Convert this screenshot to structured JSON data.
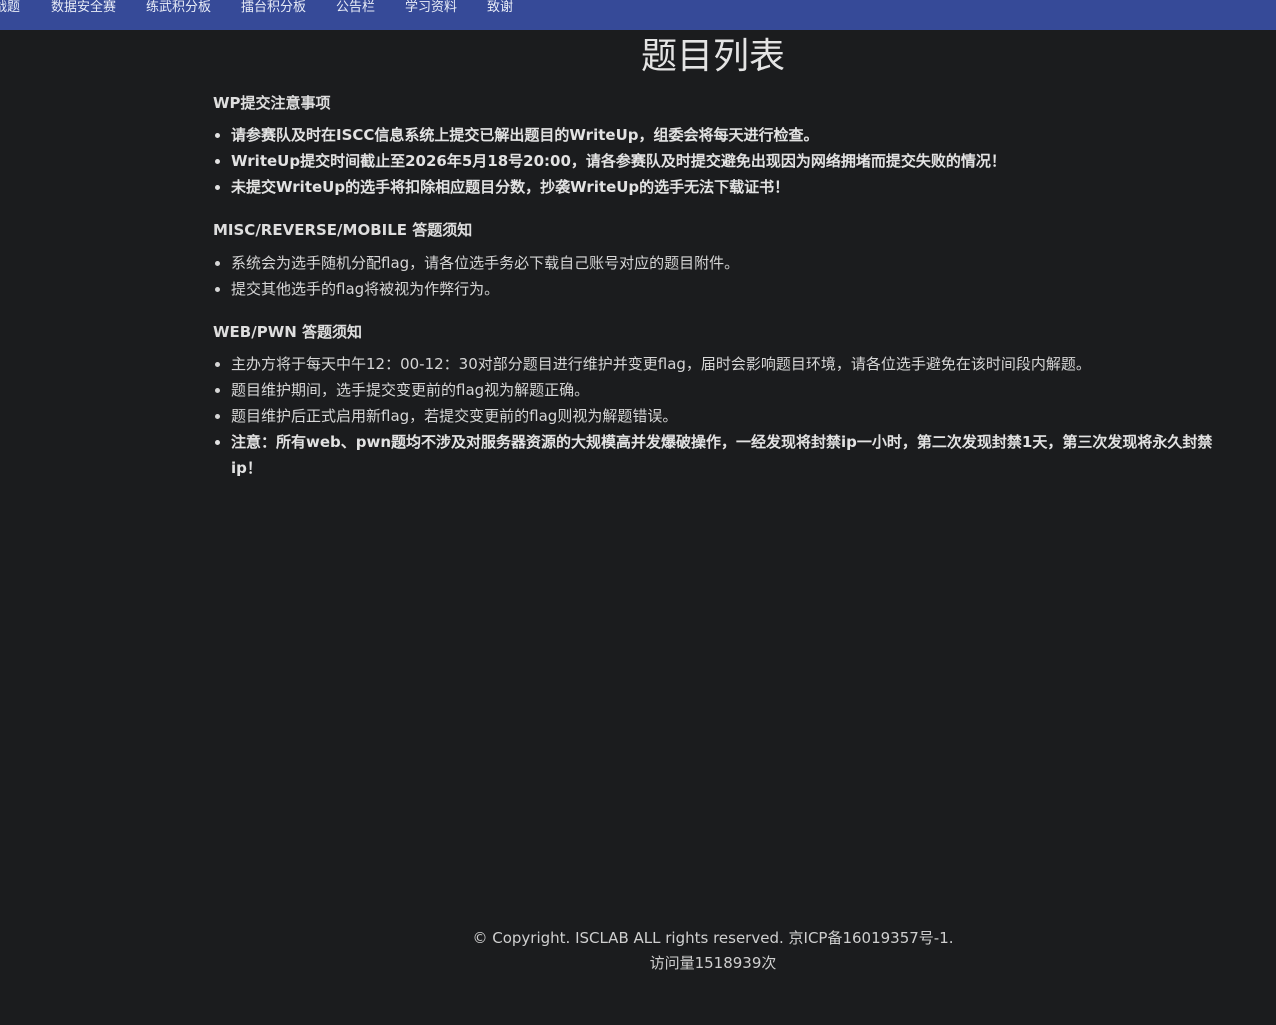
{
  "nav": {
    "items": [
      "战题",
      "数据安全赛",
      "练武积分板",
      "擂台积分板",
      "公告栏",
      "学习资料",
      "致谢"
    ],
    "background": "#364a98"
  },
  "page_title": "题目列表",
  "sections": [
    {
      "heading": "WP提交注意事项",
      "items": [
        {
          "text": "请参赛队及时在ISCC信息系统上提交已解出题目的WriteUp，组委会将每天进行检查。",
          "bold": true
        },
        {
          "text": "WriteUp提交时间截止至2026年5月18号20:00，请各参赛队及时提交避免出现因为网络拥堵而提交失败的情况！",
          "bold": true
        },
        {
          "text": "未提交WriteUp的选手将扣除相应题目分数，抄袭WriteUp的选手无法下载证书！",
          "bold": true
        }
      ]
    },
    {
      "heading": "MISC/REVERSE/MOBILE 答题须知",
      "items": [
        {
          "text": "系统会为选手随机分配flag，请各位选手务必下载自己账号对应的题目附件。",
          "bold": false
        },
        {
          "text": "提交其他选手的flag将被视为作弊行为。",
          "bold": false
        }
      ]
    },
    {
      "heading": "WEB/PWN 答题须知",
      "items": [
        {
          "text": "主办方将于每天中午12：00-12：30对部分题目进行维护并变更flag，届时会影响题目环境，请各位选手避免在该时间段内解题。",
          "bold": false
        },
        {
          "text": "题目维护期间，选手提交变更前的flag视为解题正确。",
          "bold": false
        },
        {
          "text": "题目维护后正式启用新flag，若提交变更前的flag则视为解题错误。",
          "bold": false
        },
        {
          "text": "注意：所有web、pwn题均不涉及对服务器资源的大规模高并发爆破操作，一经发现将封禁ip一小时，第二次发现封禁1天，第三次发现将永久封禁ip！",
          "bold": true
        }
      ]
    }
  ],
  "footer": {
    "copyright": "© Copyright. ISCLAB ALL rights reserved. 京ICP备16019357号-1.",
    "visits": "访问量1518939次"
  }
}
